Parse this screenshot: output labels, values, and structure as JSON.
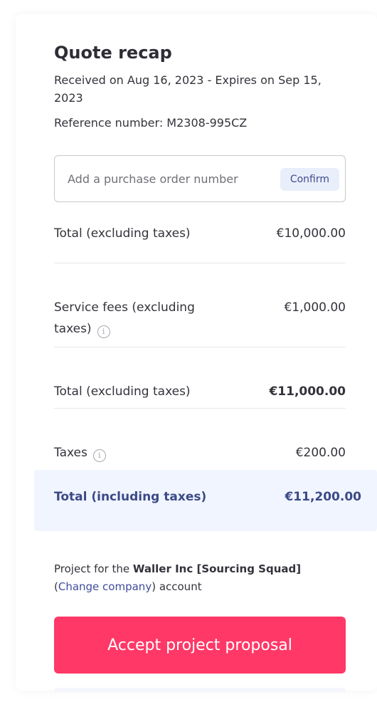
{
  "quote": {
    "title": "Quote recap",
    "received_expires": "Received on Aug 16, 2023 - Expires on Sep 15, 2023",
    "reference": "Reference number: M2308-995CZ"
  },
  "purchase_order": {
    "placeholder": "Add a purchase order number",
    "value": "",
    "confirm_label": "Confirm"
  },
  "summary": {
    "rows": [
      {
        "label": "Total (excluding taxes)",
        "value": "€10,000.00"
      },
      {
        "label": "Service fees (excluding taxes)",
        "value": "€1,000.00",
        "info_icon": "info-icon"
      },
      {
        "label": "Total (excluding taxes)",
        "value": "€11,000.00"
      },
      {
        "label": "Taxes",
        "value": "€200.00",
        "info_icon": "info-icon"
      }
    ],
    "grand_total": {
      "label": "Total (including taxes)",
      "value": "€11,200.00"
    }
  },
  "project": {
    "prefix": "Project for the ",
    "company": "Waller Inc [Sourcing Squad]",
    "open_paren": "(",
    "change_link": "Change company",
    "suffix": ") account"
  },
  "actions": {
    "accept_label": "Accept project proposal"
  },
  "colors": {
    "accent": "#ff3867",
    "total_bg": "#f1f5ff",
    "total_text": "#3b4a86",
    "link": "#3f4d9a"
  }
}
